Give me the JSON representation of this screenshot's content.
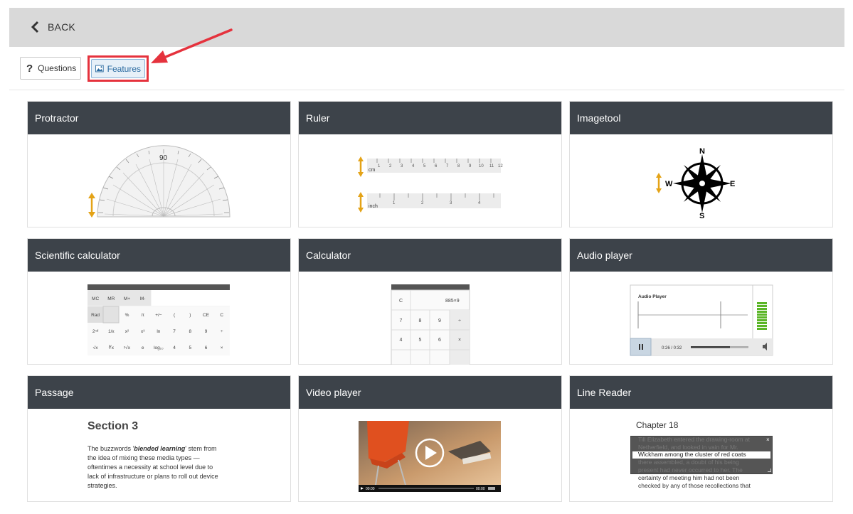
{
  "topbar": {
    "back_label": "BACK"
  },
  "tabs": {
    "questions_label": "Questions",
    "features_label": "Features"
  },
  "cards": [
    {
      "title": "Protractor"
    },
    {
      "title": "Ruler"
    },
    {
      "title": "Imagetool"
    },
    {
      "title": "Scientific calculator"
    },
    {
      "title": "Calculator"
    },
    {
      "title": "Audio player"
    },
    {
      "title": "Passage"
    },
    {
      "title": "Video player"
    },
    {
      "title": "Line Reader"
    }
  ],
  "protractor": {
    "top_label": "90"
  },
  "ruler": {
    "cm_unit": "cm",
    "inch_unit": "inch",
    "cm_ticks": [
      "1",
      "2",
      "3",
      "4",
      "5",
      "6",
      "7",
      "8",
      "9",
      "10",
      "11",
      "12"
    ],
    "inch_ticks": [
      "1",
      "2",
      "3",
      "4"
    ]
  },
  "compass": {
    "n": "N",
    "e": "E",
    "s": "S",
    "w": "W"
  },
  "sci_calc": {
    "rows": [
      [
        "MC",
        "MR",
        "M+",
        "M-"
      ],
      [
        "Rad",
        "",
        "%",
        "π",
        "+/−",
        "(",
        ")",
        "CE",
        "C"
      ],
      [
        "2ⁿᵈ",
        "1/x",
        "x²",
        "x³",
        "ln",
        "7",
        "8",
        "9",
        "÷"
      ],
      [
        "√x",
        "∛x",
        "ʸ√x",
        "e",
        "log₁₀",
        "4",
        "5",
        "6",
        "×"
      ]
    ]
  },
  "calc": {
    "clear": "C",
    "display": "885×9",
    "rows": [
      [
        "7",
        "8",
        "9",
        "÷"
      ],
      [
        "4",
        "5",
        "6",
        "×"
      ]
    ]
  },
  "audio": {
    "title": "Audio Player",
    "time": "0:26 / 0:32"
  },
  "passage": {
    "heading": "Section 3",
    "line1_pre": "The buzzwords '",
    "line1_em": "blended learning",
    "line1_post": "' stem from",
    "line2": "the idea of mixing these media types —",
    "line3": "oftentimes a necessity at school level due to",
    "line4": "lack of infrastructure or plans to roll out device",
    "line5": "strategies."
  },
  "video": {
    "time_start": "00:00",
    "time_end": "00:00"
  },
  "line_reader": {
    "chapter": "Chapter 18",
    "line1": "Till Elizabeth entered the drawing-room at",
    "line2": "Netherfield, and looked in vain for Mr.",
    "line3": "Wickham among the cluster of red coats",
    "line4": "there assembled, a doubt of his being",
    "line5": "present had never occurred to her. The",
    "line6": "certainty of meeting him had not been",
    "line7": "checked by any of those recollections that"
  }
}
